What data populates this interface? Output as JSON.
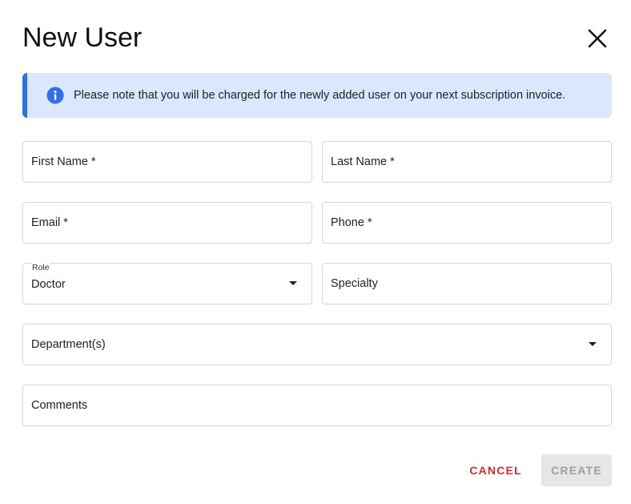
{
  "dialog": {
    "title": "New User",
    "close_icon": "close-icon"
  },
  "notice": {
    "icon": "info-icon",
    "text": "Please note that you will be charged for the newly added user on your next subscription invoice.",
    "accent_color": "#2f6fea",
    "background_color": "#dbe7fd"
  },
  "form": {
    "first_name": {
      "label": "First Name *"
    },
    "last_name": {
      "label": "Last Name *"
    },
    "email": {
      "label": "Email *"
    },
    "phone": {
      "label": "Phone *"
    },
    "role": {
      "label": "Role",
      "value": "Doctor"
    },
    "specialty": {
      "label": "Specialty"
    },
    "departments": {
      "label": "Department(s)"
    },
    "comments": {
      "label": "Comments"
    }
  },
  "actions": {
    "cancel_label": "CANCEL",
    "create_label": "CREATE",
    "cancel_color": "#e0282e"
  }
}
